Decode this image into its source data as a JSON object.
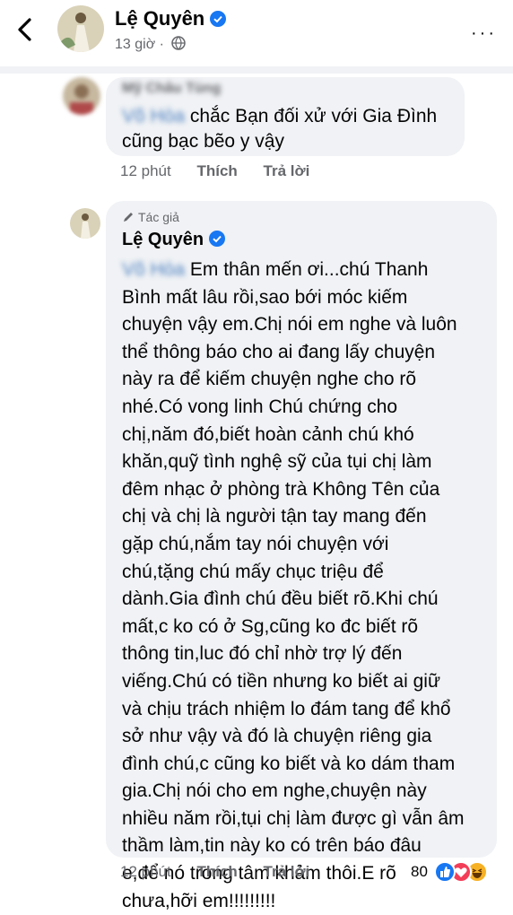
{
  "header": {
    "name": "Lệ Quyên",
    "time": "13 giờ",
    "more": "···"
  },
  "comments": [
    {
      "author": "Mỹ Châu Tùng",
      "mention": "Võ Hòa",
      "text": "chắc Bạn đối xử với Gia Đình cũng bạc bẽo y vậy",
      "time": "12 phút",
      "like": "Thích",
      "reply": "Trả lời"
    },
    {
      "author_tag": "Tác giả",
      "author": "Lệ Quyên",
      "mention": "Võ Hòa",
      "text": "Em thân mến ơi...chú Thanh\nBình mất lâu rồi,sao bới móc kiếm\nchuyện vậy em.Chị nói em nghe và luôn\nthể thông báo cho ai đang lấy chuyện\nnày ra để kiếm chuyện nghe cho rõ\nnhé.Có vong linh Chú chứng cho\nchị,năm đó,biết hoàn cảnh chú khó\nkhăn,quỹ tình nghệ sỹ của tụi chị làm\nđêm nhạc ở phòng trà Không Tên của\nchị và chị là người tận tay mang đến\ngặp chú,nắm tay nói chuyện với\nchú,tặng chú mấy chục triệu để\ndành.Gia đình chú đều biết rõ.Khi chú\nmất,c ko có ở Sg,cũng ko đc biết rõ\nthông tin,luc đó chỉ nhờ trợ lý đến\nviếng.Chú có tiền nhưng ko biết ai giữ\nvà chịu trách nhiệm lo đám tang để khổ\nsở như vậy và đó là chuyện riêng gia\nđình chú,c cũng ko biết và ko dám tham\ngia.Chị nói cho em nghe,chuyện này\nnhiều năm rồi,tụi chị làm được gì vẫn âm\nthầm làm,tin này ko có trên báo đâu\ne,để nó trong tâm khảm thôi.E rõ\nchưa,hỡi em!!!!!!!!!",
      "time": "12 phút",
      "like": "Thích",
      "reply": "Trả lời",
      "reaction_count": "80",
      "reaction_icons": [
        "like-icon",
        "love-icon",
        "haha-icon"
      ]
    }
  ],
  "colors": {
    "bubble": "#f0f2f5",
    "secondary_text": "#65676b",
    "verified_blue": "#1877f2",
    "love_red": "#f33e58",
    "haha_yellow": "#f7b125"
  }
}
